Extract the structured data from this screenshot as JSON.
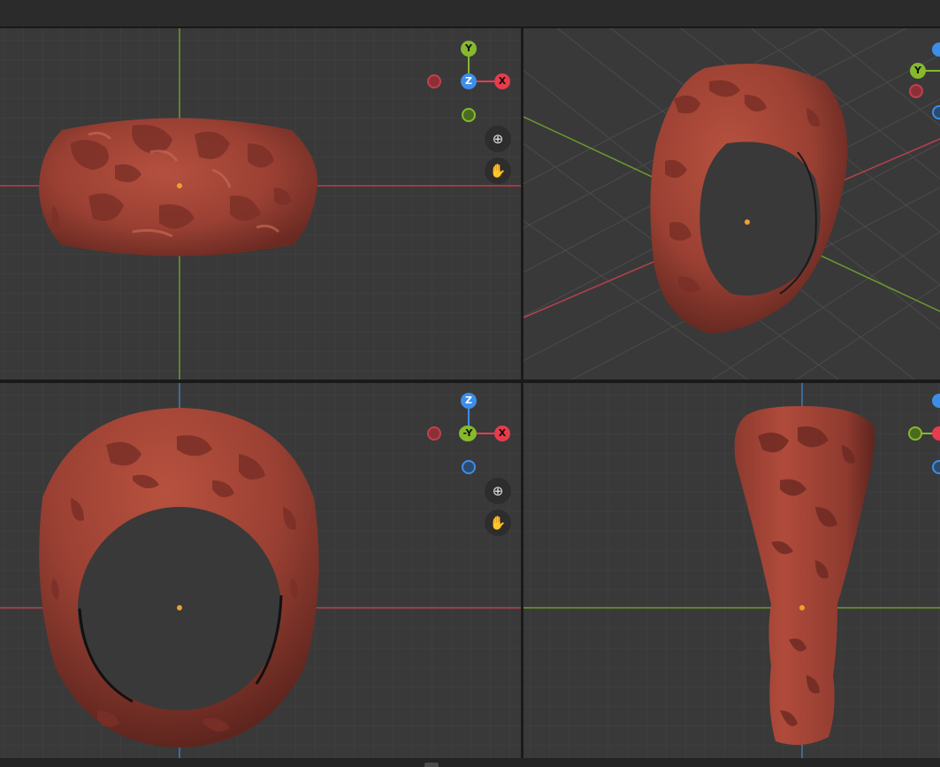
{
  "app": "3D viewport — quad view",
  "colors": {
    "x_axis": "#e63c4e",
    "y_axis": "#86b92c",
    "z_axis": "#3e8ee8",
    "grid_bg": "#393939",
    "material": "#a3463a"
  },
  "viewports": {
    "top": {
      "gizmo": {
        "center": "Z",
        "right": "X",
        "up": "Y"
      }
    },
    "user_perspective": {
      "gizmo": {
        "left": "Y"
      }
    },
    "front": {
      "gizmo": {
        "center": "-Y",
        "right": "X",
        "up": "Z"
      }
    },
    "right": {
      "gizmo": {}
    }
  },
  "icons": {
    "zoom": "zoom-in-icon",
    "pan": "hand-pan-icon"
  },
  "nav": {
    "zoom_glyph": "⊕",
    "pan_glyph": "✋"
  }
}
